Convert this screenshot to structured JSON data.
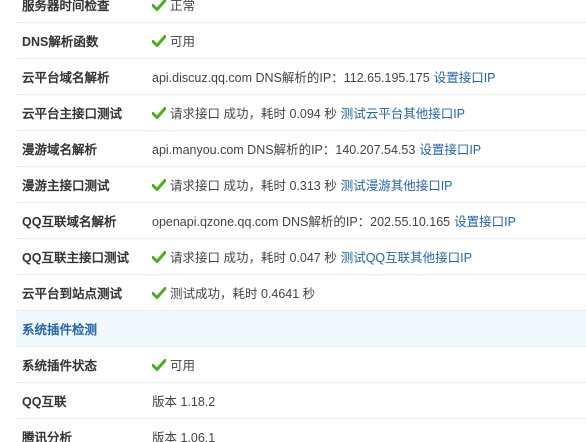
{
  "rows": {
    "server_time": {
      "label": "服务器时间检查",
      "status": "正常"
    },
    "dns_func": {
      "label": "DNS解析函数",
      "status": "可用"
    },
    "cloud_domain": {
      "label": "云平台域名解析",
      "text": "api.discuz.qq.com DNS解析的IP：112.65.195.175",
      "link": "设置接口IP"
    },
    "cloud_main": {
      "label": "云平台主接口测试",
      "text": "请求接口 成功，耗时 0.094 秒",
      "link": "测试云平台其他接口IP"
    },
    "manyou_domain": {
      "label": "漫游域名解析",
      "text": "api.manyou.com DNS解析的IP：140.207.54.53",
      "link": "设置接口IP"
    },
    "manyou_main": {
      "label": "漫游主接口测试",
      "text": "请求接口 成功，耗时 0.313 秒",
      "link": "测试漫游其他接口IP"
    },
    "qq_domain": {
      "label": "QQ互联域名解析",
      "text": "openapi.qzone.qq.com DNS解析的IP：202.55.10.165",
      "link": "设置接口IP"
    },
    "qq_main": {
      "label": "QQ互联主接口测试",
      "text": "请求接口 成功，耗时 0.047 秒",
      "link": "测试QQ互联其他接口IP"
    },
    "cloud_site": {
      "label": "云平台到站点测试",
      "text": "测试成功，耗时 0.4641 秒"
    },
    "plugin_section": {
      "label": "系统插件检测"
    },
    "plugin_status": {
      "label": "系统插件状态",
      "status": "可用"
    },
    "qq_connect": {
      "label": "QQ互联",
      "text": "版本 1.18.2"
    },
    "tencent_analytics": {
      "label": "腾讯分析",
      "text": "版本 1.06.1"
    }
  },
  "colors": {
    "check": "#4cae1e",
    "link": "#2366a8",
    "section_bg": "#f2f9fd"
  },
  "icons": {
    "status_ok": "check-icon"
  }
}
